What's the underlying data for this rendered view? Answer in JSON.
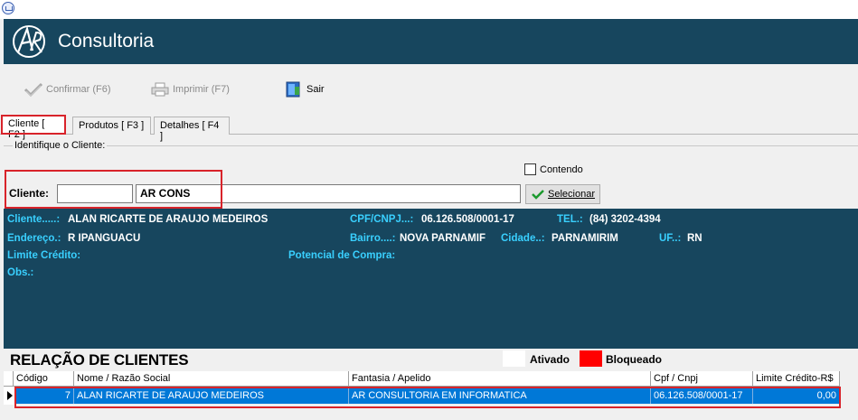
{
  "app": {
    "name": "Consultoria"
  },
  "toolbar": {
    "confirm_label": "Confirmar (F6)",
    "print_label": "Imprimir  (F7)",
    "exit_label": "Sair"
  },
  "tabs": [
    {
      "label": "Cliente [ F2 ]"
    },
    {
      "label": "Produtos [ F3 ]"
    },
    {
      "label": "Detalhes [ F4 ]"
    }
  ],
  "identify": {
    "group_label": "Identifique o Cliente:",
    "contendo_label": "Contendo",
    "contendo_checked": false,
    "cliente_label": "Cliente:",
    "code_value": "",
    "name_value": "AR CONS",
    "select_label": "Selecionar"
  },
  "info": {
    "cliente_label": "Cliente.....:",
    "cliente_value": "ALAN RICARTE DE ARAUJO MEDEIROS",
    "cpf_label": "CPF/CNPJ...:",
    "cpf_value": "06.126.508/0001-17",
    "tel_label": "TEL.:",
    "tel_value": "(84) 3202-4394",
    "endereco_label": "Endereço.:",
    "endereco_value": "R IPANGUACU",
    "bairro_label": "Bairro....:",
    "bairro_value": "NOVA PARNAMIF",
    "cidade_label": "Cidade..:",
    "cidade_value": "PARNAMIRIM",
    "uf_label": "UF..:",
    "uf_value": "RN",
    "limite_label": "Limite Crédito:",
    "potencial_label": "Potencial de Compra:",
    "obs_label": "Obs.:"
  },
  "relacao": {
    "title": "RELAÇÃO DE CLIENTES",
    "ativado_label": "Ativado",
    "bloqueado_label": "Bloqueado",
    "ativado_color": "#ffffff",
    "bloqueado_color": "#ff0000"
  },
  "grid": {
    "columns": [
      "Código",
      "Nome / Razão Social",
      "Fantasia / Apelido",
      "Cpf / Cnpj",
      "Limite Crédito-R$"
    ],
    "rows": [
      [
        "7",
        "ALAN RICARTE DE ARAUJO MEDEIROS",
        "AR CONSULTORIA EM INFORMATICA",
        "06.126.508/0001-17",
        "0,00"
      ]
    ]
  },
  "colors": {
    "header_bg": "#17465e",
    "label_cyan": "#39d0ff",
    "selection": "#0078d7",
    "highlight_red": "#d8232a"
  }
}
